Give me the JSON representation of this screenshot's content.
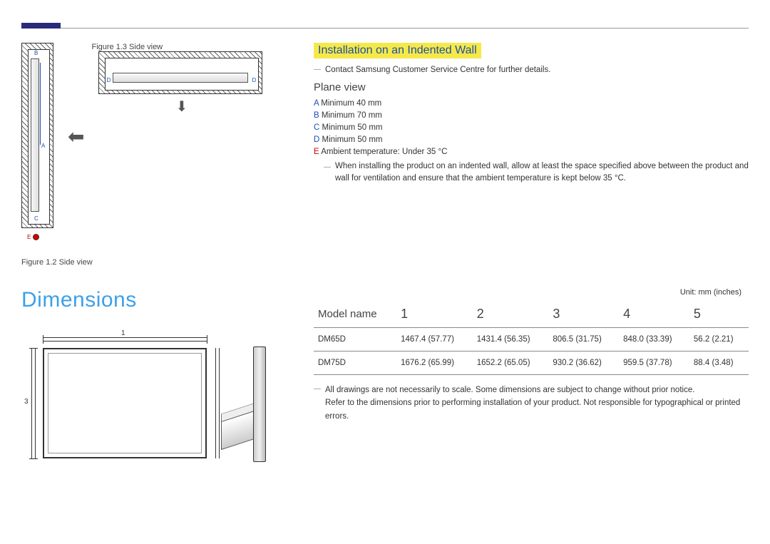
{
  "figures": {
    "fig13_label": "Figure 1.3  Side view",
    "fig12_label": "Figure 1.2  Side view",
    "labels": {
      "A": "A",
      "B": "B",
      "C": "C",
      "D": "D",
      "E": "E"
    }
  },
  "section": {
    "title": "Installation on an Indented Wall",
    "contact": "Contact Samsung Customer Service Centre for further details.",
    "plane_view": "Plane view",
    "spec_a": "Minimum 40 mm",
    "spec_b": "Minimum 70 mm",
    "spec_c": "Minimum 50 mm",
    "spec_d": "Minimum 50 mm",
    "spec_e": "Ambient temperature: Under 35 °C",
    "note": "When installing the product on an indented wall, allow at least the space specified above between the product and wall for ventilation and ensure that the ambient temperature is kept below 35 °C."
  },
  "dimensions": {
    "heading": "Dimensions",
    "unit": "Unit: mm (inches)",
    "headers": {
      "model": "Model name",
      "c1": "1",
      "c2": "2",
      "c3": "3",
      "c4": "4",
      "c5": "5"
    },
    "rows": [
      {
        "model": "DM65D",
        "c1": "1467.4 (57.77)",
        "c2": "1431.4 (56.35)",
        "c3": "806.5 (31.75)",
        "c4": "848.0 (33.39)",
        "c5": "56.2 (2.21)"
      },
      {
        "model": "DM75D",
        "c1": "1676.2 (65.99)",
        "c2": "1652.2 (65.05)",
        "c3": "930.2 (36.62)",
        "c4": "959.5 (37.78)",
        "c5": "88.4 (3.48)"
      }
    ],
    "note1": "All drawings are not necessarily to scale. Some dimensions are subject to change without prior notice.",
    "note2": "Refer to the dimensions prior to performing installation of your product. Not responsible for typographical or printed errors."
  }
}
